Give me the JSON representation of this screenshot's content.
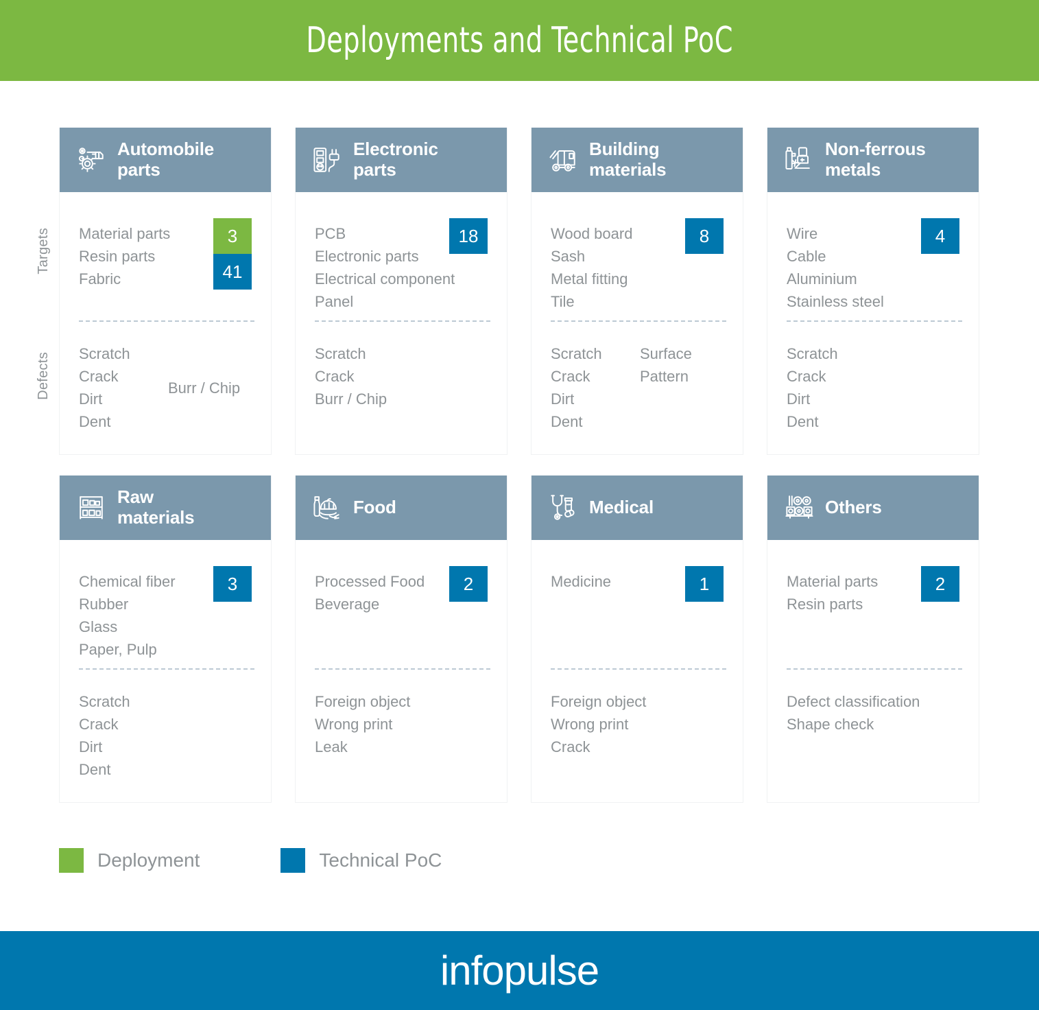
{
  "header": {
    "title": "Deployments and Technical PoC",
    "background_color": "#7CB842"
  },
  "axis_labels": {
    "targets": "Targets",
    "defects": "Defects"
  },
  "colors": {
    "deployment": "#7CB842",
    "technical_poc": "#0077AE",
    "card_header": "#7B98AC",
    "text_gray": "#8e9396",
    "divider": "#bcc9d4"
  },
  "cards": [
    {
      "title_line1": "Automobile",
      "title_line2": "parts",
      "icon": "gear-car-icon",
      "targets": [
        "Material parts",
        "Resin parts",
        "Fabric"
      ],
      "badges": [
        {
          "value": "3",
          "type": "deployment"
        },
        {
          "value": "41",
          "type": "technical_poc"
        }
      ],
      "defects_col1": [
        "Scratch",
        "Crack",
        "Dirt",
        "Dent"
      ],
      "defects_col2": [
        "Burr / Chip"
      ],
      "defects_col2_align": "centered"
    },
    {
      "title_line1": "Electronic",
      "title_line2": "parts",
      "icon": "power-strip-plug-icon",
      "targets": [
        "PCB",
        "Electronic parts",
        "Electrical component",
        "Panel"
      ],
      "badges": [
        {
          "value": "18",
          "type": "technical_poc"
        }
      ],
      "defects_col1": [
        "Scratch",
        "Crack",
        "Burr / Chip"
      ],
      "defects_col2": [],
      "defects_col2_align": "top"
    },
    {
      "title_line1": "Building",
      "title_line2": "materials",
      "icon": "cement-truck-icon",
      "targets": [
        "Wood board",
        "Sash",
        "Metal fitting",
        "Tile"
      ],
      "badges": [
        {
          "value": "8",
          "type": "technical_poc"
        }
      ],
      "defects_col1": [
        "Scratch",
        "Crack",
        "Dirt",
        "Dent"
      ],
      "defects_col2": [
        "Surface",
        "Pattern"
      ],
      "defects_col2_align": "top"
    },
    {
      "title_line1": "Non-ferrous",
      "title_line2": "metals",
      "icon": "welder-icon",
      "targets": [
        "Wire",
        "Cable",
        "Aluminium",
        "Stainless steel"
      ],
      "badges": [
        {
          "value": "4",
          "type": "technical_poc"
        }
      ],
      "defects_col1": [
        "Scratch",
        "Crack",
        "Dirt",
        "Dent"
      ],
      "defects_col2": [],
      "defects_col2_align": "top"
    },
    {
      "title_line1": "Raw",
      "title_line2": "materials",
      "icon": "warehouse-shelf-icon",
      "targets": [
        "Chemical fiber",
        "Rubber",
        "Glass",
        "Paper, Pulp"
      ],
      "badges": [
        {
          "value": "3",
          "type": "technical_poc"
        }
      ],
      "defects_col1": [
        "Scratch",
        "Crack",
        "Dirt",
        "Dent"
      ],
      "defects_col2": [],
      "defects_col2_align": "top"
    },
    {
      "title_line1": "Food",
      "title_line2": "",
      "icon": "grocery-basket-icon",
      "targets": [
        "Processed Food",
        "Beverage"
      ],
      "badges": [
        {
          "value": "2",
          "type": "technical_poc"
        }
      ],
      "defects_col1": [
        "Foreign object",
        "Wrong print",
        "Leak"
      ],
      "defects_col2": [],
      "defects_col2_align": "top"
    },
    {
      "title_line1": "Medical",
      "title_line2": "",
      "icon": "stethoscope-pills-icon",
      "targets": [
        "Medicine"
      ],
      "badges": [
        {
          "value": "1",
          "type": "technical_poc"
        }
      ],
      "defects_col1": [
        "Foreign object",
        "Wrong print",
        "Crack"
      ],
      "defects_col2": [],
      "defects_col2_align": "top"
    },
    {
      "title_line1": "Others",
      "title_line2": "",
      "icon": "sushi-tray-icon",
      "targets": [
        "Material parts",
        "Resin parts"
      ],
      "badges": [
        {
          "value": "2",
          "type": "technical_poc"
        }
      ],
      "defects_col1": [
        "Defect classification",
        "Shape check"
      ],
      "defects_col2": [],
      "defects_col2_align": "top"
    }
  ],
  "legend": [
    {
      "label": "Deployment",
      "color_key": "green"
    },
    {
      "label": "Technical PoC",
      "color_key": "blue"
    }
  ],
  "footer": {
    "logo": "infopulse",
    "background_color": "#0077AE"
  }
}
